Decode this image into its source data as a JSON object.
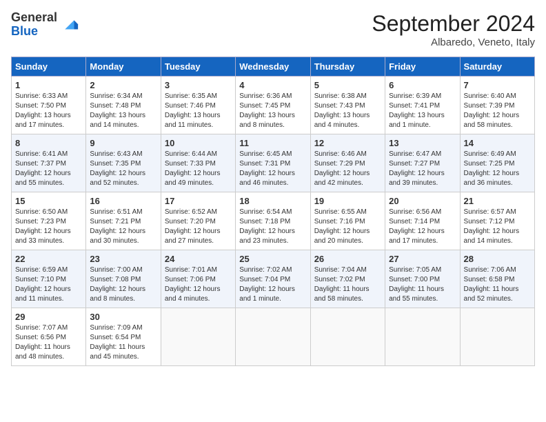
{
  "header": {
    "logo_general": "General",
    "logo_blue": "Blue",
    "month": "September 2024",
    "location": "Albaredo, Veneto, Italy"
  },
  "days_of_week": [
    "Sunday",
    "Monday",
    "Tuesday",
    "Wednesday",
    "Thursday",
    "Friday",
    "Saturday"
  ],
  "weeks": [
    [
      {
        "day": "1",
        "lines": [
          "Sunrise: 6:33 AM",
          "Sunset: 7:50 PM",
          "Daylight: 13 hours",
          "and 17 minutes."
        ]
      },
      {
        "day": "2",
        "lines": [
          "Sunrise: 6:34 AM",
          "Sunset: 7:48 PM",
          "Daylight: 13 hours",
          "and 14 minutes."
        ]
      },
      {
        "day": "3",
        "lines": [
          "Sunrise: 6:35 AM",
          "Sunset: 7:46 PM",
          "Daylight: 13 hours",
          "and 11 minutes."
        ]
      },
      {
        "day": "4",
        "lines": [
          "Sunrise: 6:36 AM",
          "Sunset: 7:45 PM",
          "Daylight: 13 hours",
          "and 8 minutes."
        ]
      },
      {
        "day": "5",
        "lines": [
          "Sunrise: 6:38 AM",
          "Sunset: 7:43 PM",
          "Daylight: 13 hours",
          "and 4 minutes."
        ]
      },
      {
        "day": "6",
        "lines": [
          "Sunrise: 6:39 AM",
          "Sunset: 7:41 PM",
          "Daylight: 13 hours",
          "and 1 minute."
        ]
      },
      {
        "day": "7",
        "lines": [
          "Sunrise: 6:40 AM",
          "Sunset: 7:39 PM",
          "Daylight: 12 hours",
          "and 58 minutes."
        ]
      }
    ],
    [
      {
        "day": "8",
        "lines": [
          "Sunrise: 6:41 AM",
          "Sunset: 7:37 PM",
          "Daylight: 12 hours",
          "and 55 minutes."
        ]
      },
      {
        "day": "9",
        "lines": [
          "Sunrise: 6:43 AM",
          "Sunset: 7:35 PM",
          "Daylight: 12 hours",
          "and 52 minutes."
        ]
      },
      {
        "day": "10",
        "lines": [
          "Sunrise: 6:44 AM",
          "Sunset: 7:33 PM",
          "Daylight: 12 hours",
          "and 49 minutes."
        ]
      },
      {
        "day": "11",
        "lines": [
          "Sunrise: 6:45 AM",
          "Sunset: 7:31 PM",
          "Daylight: 12 hours",
          "and 46 minutes."
        ]
      },
      {
        "day": "12",
        "lines": [
          "Sunrise: 6:46 AM",
          "Sunset: 7:29 PM",
          "Daylight: 12 hours",
          "and 42 minutes."
        ]
      },
      {
        "day": "13",
        "lines": [
          "Sunrise: 6:47 AM",
          "Sunset: 7:27 PM",
          "Daylight: 12 hours",
          "and 39 minutes."
        ]
      },
      {
        "day": "14",
        "lines": [
          "Sunrise: 6:49 AM",
          "Sunset: 7:25 PM",
          "Daylight: 12 hours",
          "and 36 minutes."
        ]
      }
    ],
    [
      {
        "day": "15",
        "lines": [
          "Sunrise: 6:50 AM",
          "Sunset: 7:23 PM",
          "Daylight: 12 hours",
          "and 33 minutes."
        ]
      },
      {
        "day": "16",
        "lines": [
          "Sunrise: 6:51 AM",
          "Sunset: 7:21 PM",
          "Daylight: 12 hours",
          "and 30 minutes."
        ]
      },
      {
        "day": "17",
        "lines": [
          "Sunrise: 6:52 AM",
          "Sunset: 7:20 PM",
          "Daylight: 12 hours",
          "and 27 minutes."
        ]
      },
      {
        "day": "18",
        "lines": [
          "Sunrise: 6:54 AM",
          "Sunset: 7:18 PM",
          "Daylight: 12 hours",
          "and 23 minutes."
        ]
      },
      {
        "day": "19",
        "lines": [
          "Sunrise: 6:55 AM",
          "Sunset: 7:16 PM",
          "Daylight: 12 hours",
          "and 20 minutes."
        ]
      },
      {
        "day": "20",
        "lines": [
          "Sunrise: 6:56 AM",
          "Sunset: 7:14 PM",
          "Daylight: 12 hours",
          "and 17 minutes."
        ]
      },
      {
        "day": "21",
        "lines": [
          "Sunrise: 6:57 AM",
          "Sunset: 7:12 PM",
          "Daylight: 12 hours",
          "and 14 minutes."
        ]
      }
    ],
    [
      {
        "day": "22",
        "lines": [
          "Sunrise: 6:59 AM",
          "Sunset: 7:10 PM",
          "Daylight: 12 hours",
          "and 11 minutes."
        ]
      },
      {
        "day": "23",
        "lines": [
          "Sunrise: 7:00 AM",
          "Sunset: 7:08 PM",
          "Daylight: 12 hours",
          "and 8 minutes."
        ]
      },
      {
        "day": "24",
        "lines": [
          "Sunrise: 7:01 AM",
          "Sunset: 7:06 PM",
          "Daylight: 12 hours",
          "and 4 minutes."
        ]
      },
      {
        "day": "25",
        "lines": [
          "Sunrise: 7:02 AM",
          "Sunset: 7:04 PM",
          "Daylight: 12 hours",
          "and 1 minute."
        ]
      },
      {
        "day": "26",
        "lines": [
          "Sunrise: 7:04 AM",
          "Sunset: 7:02 PM",
          "Daylight: 11 hours",
          "and 58 minutes."
        ]
      },
      {
        "day": "27",
        "lines": [
          "Sunrise: 7:05 AM",
          "Sunset: 7:00 PM",
          "Daylight: 11 hours",
          "and 55 minutes."
        ]
      },
      {
        "day": "28",
        "lines": [
          "Sunrise: 7:06 AM",
          "Sunset: 6:58 PM",
          "Daylight: 11 hours",
          "and 52 minutes."
        ]
      }
    ],
    [
      {
        "day": "29",
        "lines": [
          "Sunrise: 7:07 AM",
          "Sunset: 6:56 PM",
          "Daylight: 11 hours",
          "and 48 minutes."
        ]
      },
      {
        "day": "30",
        "lines": [
          "Sunrise: 7:09 AM",
          "Sunset: 6:54 PM",
          "Daylight: 11 hours",
          "and 45 minutes."
        ]
      },
      {
        "day": "",
        "lines": []
      },
      {
        "day": "",
        "lines": []
      },
      {
        "day": "",
        "lines": []
      },
      {
        "day": "",
        "lines": []
      },
      {
        "day": "",
        "lines": []
      }
    ]
  ]
}
